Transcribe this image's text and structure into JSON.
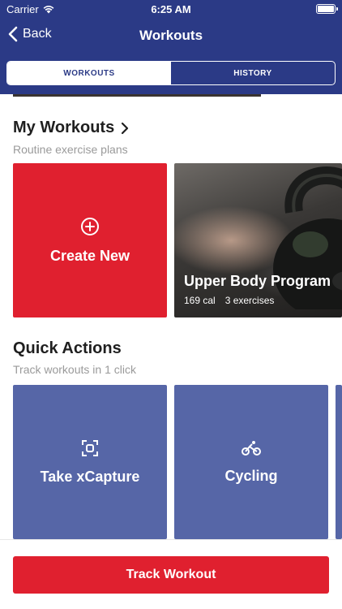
{
  "status_bar": {
    "carrier": "Carrier",
    "time": "6:25 AM"
  },
  "nav": {
    "back_label": "Back",
    "title": "Workouts"
  },
  "tabs": [
    {
      "label": "WORKOUTS",
      "active": true
    },
    {
      "label": "HISTORY",
      "active": false
    }
  ],
  "my_workouts": {
    "title": "My Workouts",
    "subtitle": "Routine exercise plans",
    "create_label": "Create New",
    "program": {
      "title": "Upper Body Program",
      "calories": "169 cal",
      "exercises": "3 exercises"
    }
  },
  "quick_actions": {
    "title": "Quick Actions",
    "subtitle": "Track workouts in 1 click",
    "items": [
      {
        "label": "Take xCapture",
        "icon": "capture-icon"
      },
      {
        "label": "Cycling",
        "icon": "cycling-icon"
      }
    ]
  },
  "bottom": {
    "track_label": "Track Workout"
  },
  "colors": {
    "nav_bg": "#2b3a86",
    "accent_red": "#e0202f",
    "quick_blue": "#5666a7"
  }
}
